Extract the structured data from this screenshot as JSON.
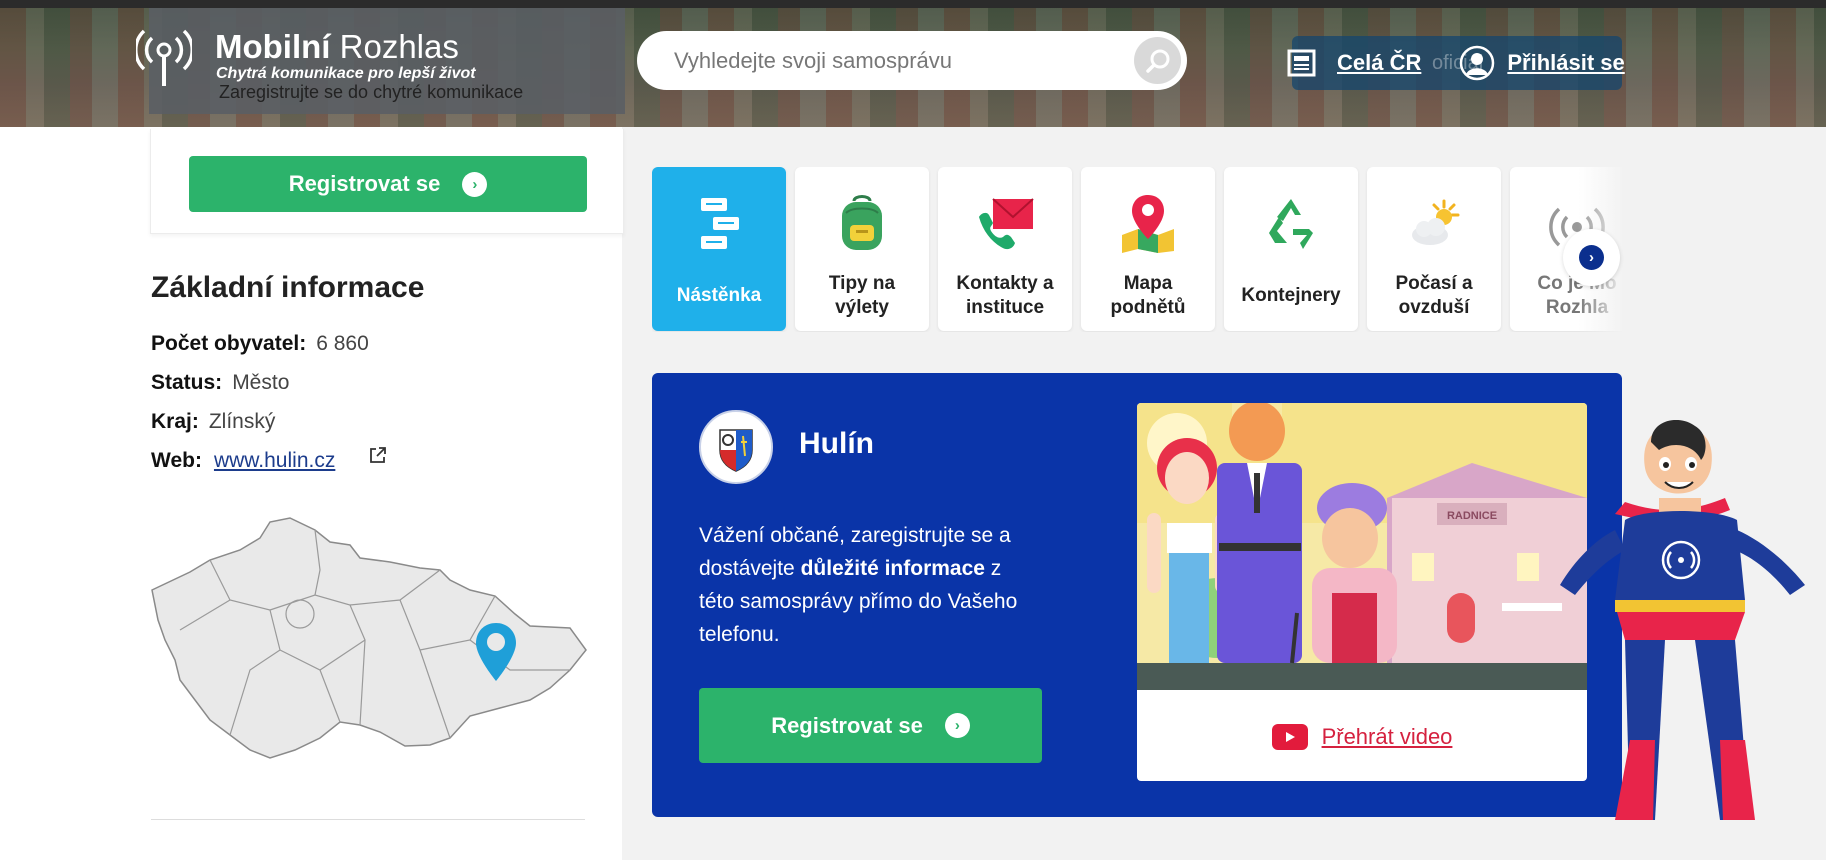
{
  "header": {
    "brand_bold": "Mobilní",
    "brand_light": " Rozhlas",
    "tagline": "Chytrá komunikace pro lepší život",
    "subtitle": "Zaregistrujte se do chytré komunikace",
    "search_placeholder": "Vyhledejte svoji samosprávu",
    "link_country": "Celá ČR",
    "link_login": "Přihlásit se",
    "ghost_text": "oficiál"
  },
  "sidebar": {
    "register_label": "Registrovat se",
    "info_title": "Základní informace",
    "rows": [
      {
        "key": "Počet obyvatel:",
        "value": "6 860"
      },
      {
        "key": "Status:",
        "value": "Město"
      },
      {
        "key": "Kraj:",
        "value": "Zlínský"
      },
      {
        "key": "Web:",
        "value": "www.hulin.cz"
      }
    ]
  },
  "tiles": [
    {
      "line1": "Nástěnka",
      "line2": "",
      "icon": "board-icon",
      "active": true
    },
    {
      "line1": "Tipy na",
      "line2": "výlety",
      "icon": "backpack-icon",
      "active": false
    },
    {
      "line1": "Kontakty a",
      "line2": "instituce",
      "icon": "phone-mail-icon",
      "active": false
    },
    {
      "line1": "Mapa",
      "line2": "podnětů",
      "icon": "map-pin-icon",
      "active": false
    },
    {
      "line1": "Kontejnery",
      "line2": "",
      "icon": "recycle-icon",
      "active": false
    },
    {
      "line1": "Počasí a",
      "line2": "ovzduší",
      "icon": "weather-icon",
      "active": false
    },
    {
      "line1": "Co je Mo",
      "line2": "Rozhla",
      "icon": "broadcast-icon",
      "active": false
    }
  ],
  "panel": {
    "town": "Hulín",
    "msg_pre": "Vážení občané, zaregistrujte se a dostávejte ",
    "msg_bold": "důležité informace",
    "msg_post": " z této samosprávy přímo do Vašeho telefonu.",
    "register_label": "Registrovat se",
    "video_label": "Přehrát video",
    "townhall_sign": "RADNICE"
  },
  "colors": {
    "green": "#2cb36b",
    "panel_blue": "#0a34a8",
    "tile_active": "#1fb0ea",
    "video_red": "#d5213f"
  }
}
